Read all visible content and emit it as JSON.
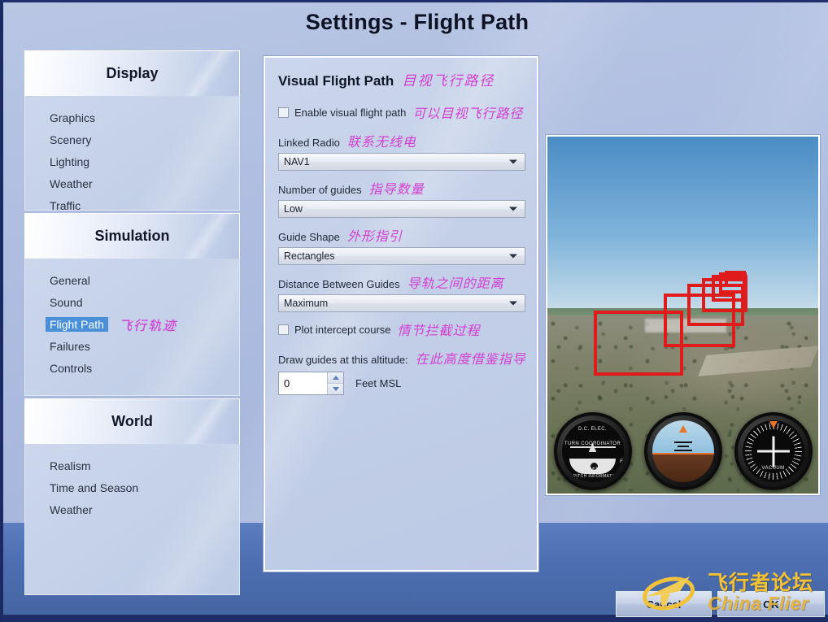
{
  "window": {
    "title": "Settings - Flight Path"
  },
  "sidebar": {
    "groups": [
      {
        "header": "Display",
        "items": [
          {
            "label": "Graphics",
            "cn": "",
            "active": false
          },
          {
            "label": "Scenery",
            "cn": "",
            "active": false
          },
          {
            "label": "Lighting",
            "cn": "",
            "active": false
          },
          {
            "label": "Weather",
            "cn": "",
            "active": false
          },
          {
            "label": "Traffic",
            "cn": "",
            "active": false
          }
        ]
      },
      {
        "header": "Simulation",
        "items": [
          {
            "label": "General",
            "cn": "",
            "active": false
          },
          {
            "label": "Sound",
            "cn": "",
            "active": false
          },
          {
            "label": "Flight Path",
            "cn": "飞行轨迹",
            "active": true
          },
          {
            "label": "Failures",
            "cn": "",
            "active": false
          },
          {
            "label": "Controls",
            "cn": "",
            "active": false
          }
        ]
      },
      {
        "header": "World",
        "items": [
          {
            "label": "Realism",
            "cn": "",
            "active": false
          },
          {
            "label": "Time and Season",
            "cn": "",
            "active": false
          },
          {
            "label": "Weather",
            "cn": "",
            "active": false
          }
        ]
      }
    ]
  },
  "panel": {
    "title_en": "Visual Flight Path",
    "title_cn": "目视飞行路径",
    "enable_checkbox": {
      "label_en": "Enable visual flight path",
      "label_cn": "可以目视飞行路径",
      "checked": false
    },
    "linked_radio": {
      "label_en": "Linked Radio",
      "label_cn": "联系无线电",
      "value": "NAV1"
    },
    "number_of_guides": {
      "label_en": "Number of guides",
      "label_cn": "指导数量",
      "value": "Low"
    },
    "guide_shape": {
      "label_en": "Guide Shape",
      "label_cn": "外形指引",
      "value": "Rectangles"
    },
    "distance_between_guides": {
      "label_en": "Distance Between Guides",
      "label_cn": "导轨之间的距离",
      "value": "Maximum"
    },
    "plot_intercept": {
      "label_en": "Plot intercept course",
      "label_cn": "情节拦截过程",
      "checked": false
    },
    "altitude": {
      "label_en": "Draw guides at this altitude:",
      "label_cn": "在此高度借鉴指导",
      "value": "0",
      "unit": "Feet MSL"
    }
  },
  "preview": {
    "gauges": [
      {
        "name": "turn-coordinator",
        "top_text": "D.C. ELEC.",
        "mid_text": "TURN COORDINATOR",
        "left_text": "L",
        "right_text": "R",
        "bottom_text": "2 MIN",
        "sub_text": "NO PITCH INFORMATION"
      },
      {
        "name": "attitude-indicator",
        "top_text": "",
        "mid_text": "",
        "left_text": "",
        "right_text": "",
        "bottom_text": "",
        "sub_text": ""
      },
      {
        "name": "heading-indicator",
        "top_text": "",
        "mid_text": "",
        "left_text": "",
        "right_text": "",
        "bottom_text": "VACUUM",
        "sub_text": ""
      }
    ]
  },
  "buttons": {
    "cancel": "Cancel",
    "ok": "OK"
  },
  "watermark": {
    "cn": "飞行者论坛",
    "en": "China Flier"
  },
  "colors": {
    "accent_highlight": "#4a90d9",
    "annotation": "#d23fd2",
    "guide_red": "#e01b1b",
    "watermark_gold": "#f2c23a",
    "title_text": "#0d1324"
  }
}
